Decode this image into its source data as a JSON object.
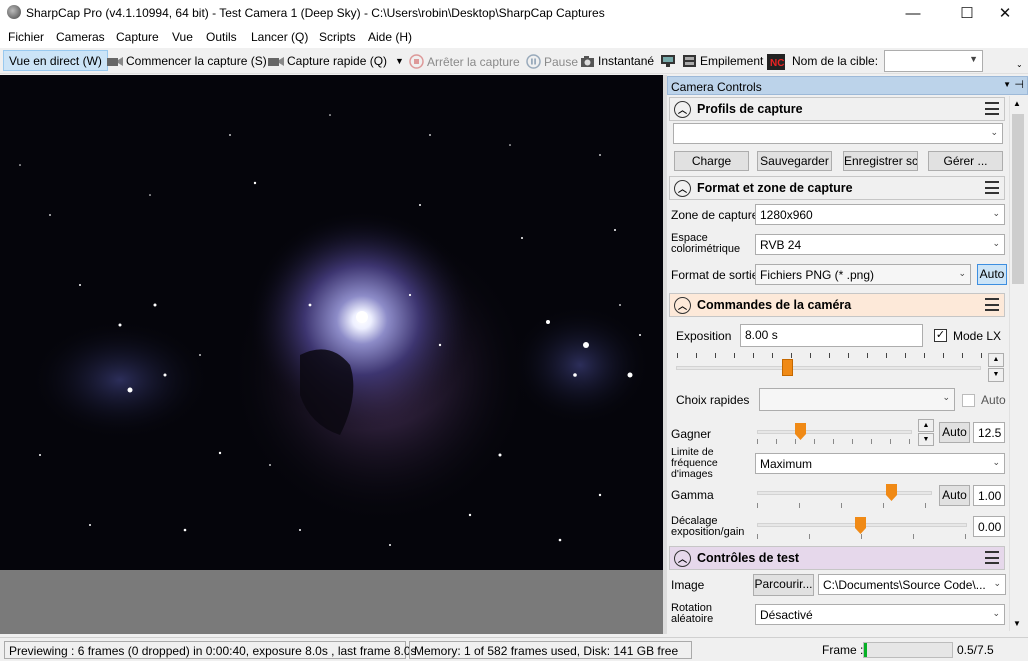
{
  "window": {
    "title": "SharpCap Pro (v4.1.10994, 64 bit) - Test Camera 1 (Deep Sky) - C:\\Users\\robin\\Desktop\\SharpCap Captures",
    "minimize": "—",
    "maximize": "☐",
    "close": "✕"
  },
  "menu": [
    "Fichier",
    "Cameras",
    "Capture",
    "Vue",
    "Outils",
    "Lancer (Q)",
    "Scripts",
    "Aide (H)"
  ],
  "toolbar": {
    "live": "Vue en direct (W)",
    "start": "Commencer la capture (S)",
    "quick": "Capture rapide (Q)",
    "stop": "Arrêter la capture",
    "pause": "Pause",
    "snapshot": "Instantané",
    "stacking": "Empilement",
    "target_label": "Nom de la cible:",
    "target_value": ""
  },
  "panel": {
    "title": "Camera Controls",
    "profiles": {
      "header": "Profils de capture",
      "selected": "",
      "buttons": [
        "Charge",
        "Sauvegarder",
        "Enregistrer sc",
        "Gérer ..."
      ]
    },
    "format": {
      "header": "Format et zone de capture",
      "zone_label": "Zone de capture",
      "zone_value": "1280x960",
      "color_label_1": "Espace",
      "color_label_2": "colorimétrique",
      "color_value": "RVB 24",
      "output_label": "Format de sortie",
      "output_value": "Fichiers PNG (* .png)",
      "auto": "Auto"
    },
    "camera": {
      "header": "Commandes de la caméra",
      "exposure_label": "Exposition",
      "exposure_value": "8.00 s",
      "lx_label": "Mode LX",
      "lx_checked": true,
      "quick_label": "Choix rapides",
      "quick_value": "",
      "quick_auto": "Auto",
      "gain_label": "Gagner",
      "gain_auto": "Auto",
      "gain_value": "12.5",
      "frame_label_1": "Limite de",
      "frame_label_2": "fréquence",
      "frame_label_3": "d'images",
      "frame_value": "Maximum",
      "gamma_label": "Gamma",
      "gamma_auto": "Auto",
      "gamma_value": "1.00",
      "offset_label_1": "Décalage",
      "offset_label_2": "exposition/gain",
      "offset_value": "0.00"
    },
    "test": {
      "header": "Contrôles de test",
      "image_label": "Image",
      "browse": "Parcourir...",
      "path": "C:\\Documents\\Source Code\\...",
      "rot_label_1": "Rotation",
      "rot_label_2": "aléatoire",
      "rot_value": "Désactivé"
    }
  },
  "status": {
    "preview": "Previewing : 6 frames (0 dropped) in 0:00:40, exposure 8.0s , last frame 8.0s",
    "memory": "Memory: 1 of 582 frames used, Disk: 141 GB free",
    "frame_label": "Frame :",
    "frame_progress": 0.03,
    "frame_value": "0.5/7.5"
  },
  "colors": {
    "accent": "#f08a16",
    "header_selected": "#cce4f7",
    "section_active": "#fde9d9",
    "section_test": "#e6d8eb"
  }
}
